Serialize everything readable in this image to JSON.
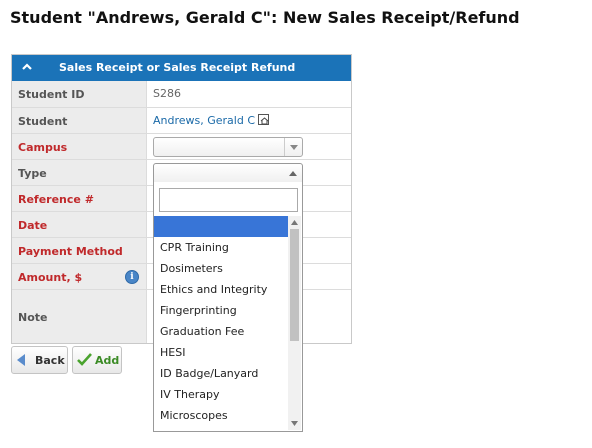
{
  "page": {
    "title": "Student \"Andrews, Gerald C\": New Sales Receipt/Refund"
  },
  "panel": {
    "title": "Sales Receipt or Sales Receipt Refund",
    "collapse_icon": "chevron-up-icon",
    "header_color": "#1b73b8"
  },
  "form": {
    "student_id": {
      "label": "Student ID",
      "value": "S286"
    },
    "student": {
      "label": "Student",
      "value": "Andrews, Gerald C",
      "icon": "external-link-icon"
    },
    "campus": {
      "label": "Campus",
      "value": ""
    },
    "type": {
      "label": "Type",
      "value": ""
    },
    "reference": {
      "label": "Reference #"
    },
    "date": {
      "label": "Date"
    },
    "payment_method": {
      "label": "Payment Method"
    },
    "amount": {
      "label": "Amount, $",
      "icon": "info-icon"
    },
    "note": {
      "label": "Note"
    },
    "required_color": "#c0292b"
  },
  "buttons": {
    "back": "Back",
    "add": "Add"
  },
  "dropdown": {
    "search_value": "",
    "highlighted_index": 0,
    "options": [
      "",
      "CPR Training",
      "Dosimeters",
      "Ethics and Integrity",
      "Fingerprinting",
      "Graduation Fee",
      "HESI",
      "ID Badge/Lanyard",
      "IV Therapy",
      "Microscopes"
    ],
    "highlight_color": "#3875d7"
  }
}
